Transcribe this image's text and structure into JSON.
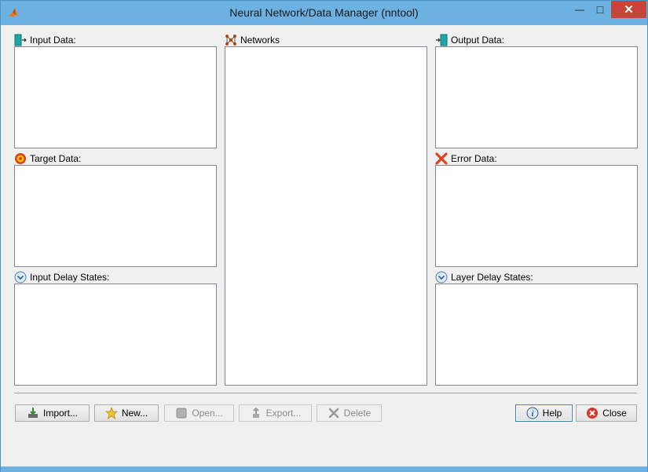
{
  "window": {
    "title": "Neural Network/Data Manager (nntool)",
    "minimize_symbol": "—",
    "maximize_symbol": "□",
    "close_symbol": "✕"
  },
  "panels": {
    "input_data": "Input Data:",
    "target_data": "Target Data:",
    "input_delay_states": "Input Delay States:",
    "networks": "Networks",
    "output_data": "Output Data:",
    "error_data": "Error Data:",
    "layer_delay_states": "Layer Delay States:"
  },
  "buttons": {
    "import": "Import...",
    "new": "New...",
    "open": "Open...",
    "export": "Export...",
    "delete": "Delete",
    "help": "Help",
    "close": "Close"
  },
  "icons": {
    "input_data": "input-arrow-icon",
    "target_data": "target-icon",
    "input_delay_states": "chevron-down-circle-icon",
    "networks": "network-icon",
    "output_data": "output-arrow-icon",
    "error_data": "red-x-icon",
    "layer_delay_states": "chevron-down-circle-icon"
  },
  "colors": {
    "titlebar": "#6cb1e1",
    "close_button": "#c7443a",
    "teal_icon": "#1fa5a5",
    "error_red": "#e0401e"
  }
}
